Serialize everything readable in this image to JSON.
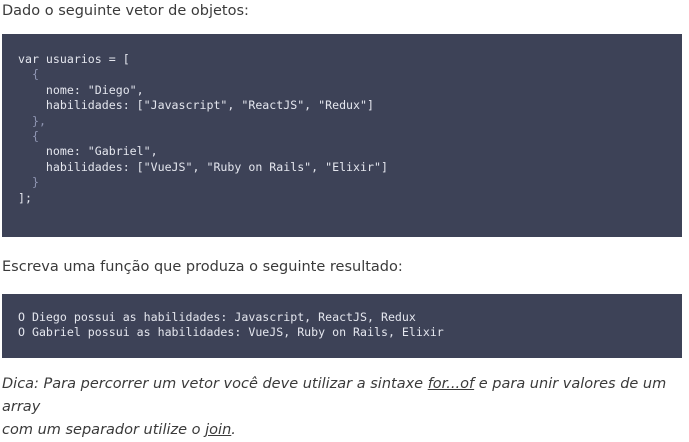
{
  "intro_text": "Dado o seguinte vetor de objetos:",
  "code_block_1": {
    "lines": [
      "var usuarios = [",
      "  {",
      "    nome: \"Diego\",",
      "    habilidades: [\"Javascript\", \"ReactJS\", \"Redux\"]",
      "  },",
      "  {",
      "    nome: \"Gabriel\",",
      "    habilidades: [\"VueJS\", \"Ruby on Rails\", \"Elixir\"]",
      "  }",
      "];"
    ]
  },
  "task_text": "Escreva uma função que produza o seguinte resultado:",
  "code_block_2": {
    "lines": [
      "O Diego possui as habilidades: Javascript, ReactJS, Redux",
      "O Gabriel possui as habilidades: VueJS, Ruby on Rails, Elixir"
    ]
  },
  "hint": {
    "part1": "Dica: Para percorrer um vetor você deve utilizar a sintaxe ",
    "link_forof": "for...of",
    "part2": " e para unir valores de um array",
    "part3": "com um separador utilize o ",
    "link_join": "join",
    "part4": "."
  },
  "colors": {
    "code_background": "#3d4257",
    "code_text": "#e4e6ee",
    "body_text": "#3a3a3a"
  }
}
